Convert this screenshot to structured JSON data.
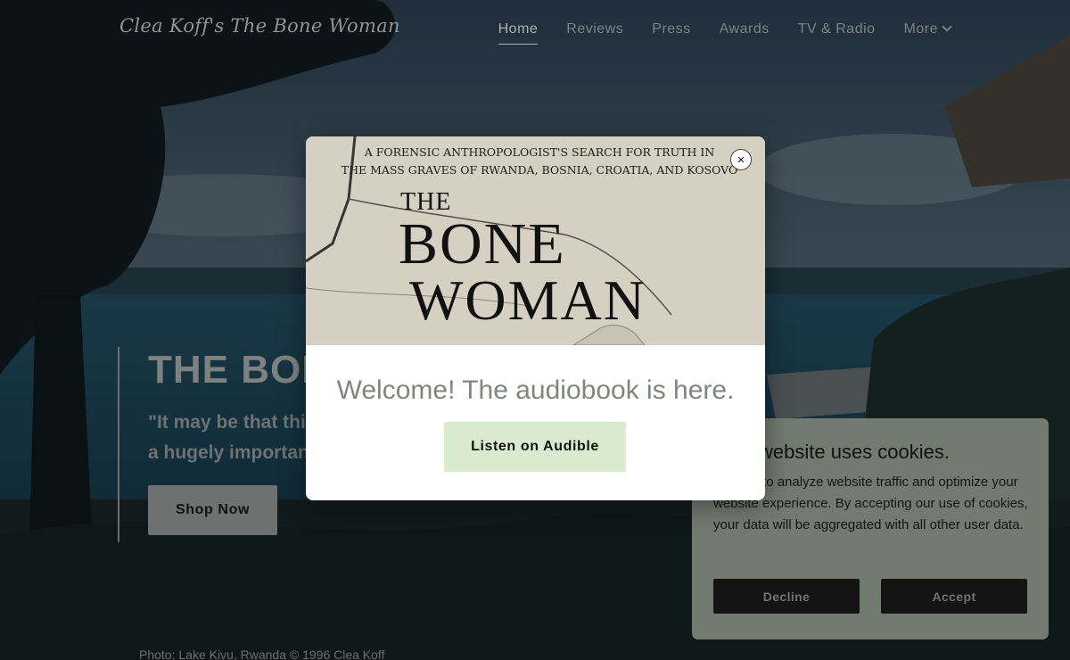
{
  "header": {
    "brand": "Clea Koff's The Bone Woman",
    "nav": [
      {
        "label": "Home",
        "active": true
      },
      {
        "label": "Reviews"
      },
      {
        "label": "Press"
      },
      {
        "label": "Awards"
      },
      {
        "label": "TV & Radio"
      },
      {
        "label": "More"
      }
    ]
  },
  "hero": {
    "title": "THE BON",
    "quote_line1": "\"It may be that this",
    "quote_line2": " a hugely importan",
    "shop_label": "Shop Now",
    "photo_credit": "Photo: Lake Kivu, Rwanda © 1996 Clea Koff"
  },
  "modal": {
    "cover": {
      "subtitle_line1": "A FORENSIC ANTHROPOLOGIST'S SEARCH FOR TRUTH IN",
      "subtitle_line2": "THE MASS GRAVES OF RWANDA, BOSNIA, CROATIA, AND KOSOVO",
      "title_the": "THE",
      "title_bone": "BONE",
      "title_woman": "WOMAN"
    },
    "close_label": "×",
    "welcome": "Welcome! The audiobook is here.",
    "cta_label": "Listen on Audible"
  },
  "cookie_banner": {
    "title": "website uses cookies.",
    "body": "cookies to analyze website traffic and optimize your website experience. By accepting our use of cookies, your data will be aggregated with all other user data.",
    "decline_label": "Decline",
    "accept_label": "Accept"
  },
  "colors": {
    "modal_cta_bg": "#d9ebcf",
    "cookie_bg": "#737a70",
    "cookie_button_bg": "#141414"
  }
}
